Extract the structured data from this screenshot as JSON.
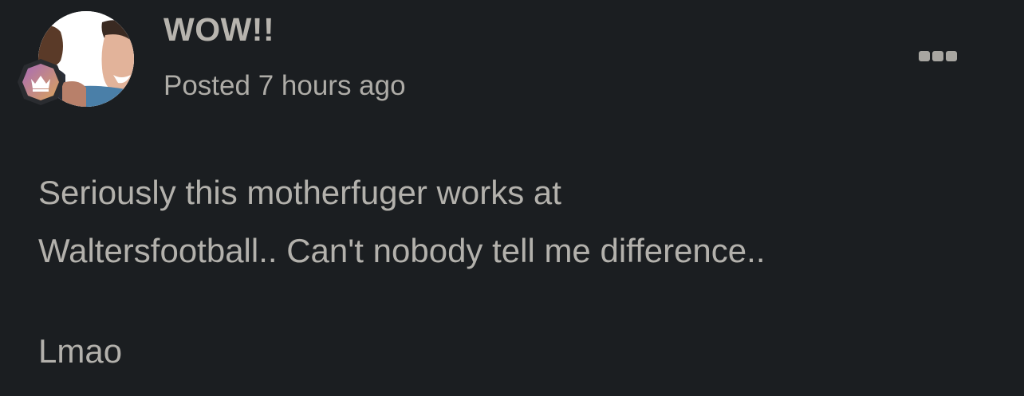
{
  "post": {
    "title": "WOW!!",
    "posted_prefix": "Posted",
    "posted_time": "7 hours ago",
    "body_lines": [
      "Seriously this motherfuger works at",
      "Waltersfootball.. Can't nobody tell me difference.."
    ],
    "body_extra": "Lmao"
  },
  "icons": {
    "avatar": "avatar-photo",
    "rank": "crown-icon",
    "menu": "more-options-icon"
  },
  "colors": {
    "background": "#1b1e21",
    "text": "#b4b2ad",
    "badge_gradient_start": "#a86ab8",
    "badge_gradient_end": "#d9a45a"
  }
}
